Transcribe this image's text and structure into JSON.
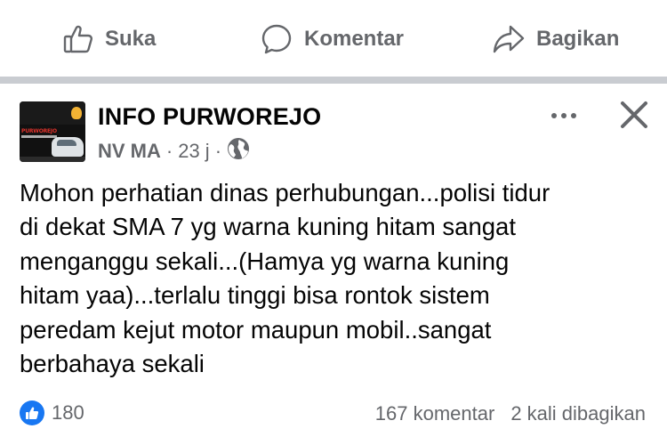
{
  "actions": {
    "like_label": "Suka",
    "comment_label": "Komentar",
    "share_label": "Bagikan"
  },
  "post": {
    "page_name": "INFO PURWOREJO",
    "avatar_logo_text": "PURWOREJO",
    "author": "NV MA",
    "separator": "·",
    "time": "23 j",
    "audience_icon": "globe-icon",
    "text": "Mohon perhatian dinas perhubungan...polisi tidur\ndi dekat SMA 7 yg warna kuning hitam sangat\nmenganggu sekali...(Hamya yg warna kuning\nhitam yaa)...terlalu tinggi bisa rontok sistem\nperedam kejut motor maupun mobil..sangat\nberbahaya sekali"
  },
  "footer": {
    "reaction_count": "180",
    "comments": "167 komentar",
    "shares": "2 kali dibagikan"
  },
  "colors": {
    "accent": "#1877f2",
    "secondary_text": "#65676b",
    "divider": "#c9ccd1"
  }
}
